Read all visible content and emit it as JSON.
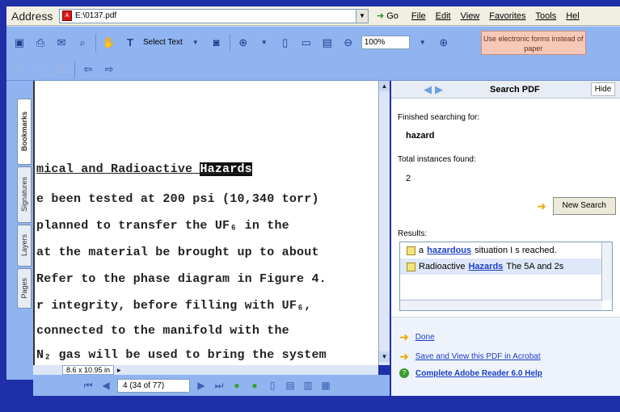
{
  "address_bar": {
    "label": "Address",
    "value": "E:\\0137.pdf",
    "go_label": "Go"
  },
  "menu": [
    "File",
    "Edit",
    "View",
    "Favorites",
    "Tools",
    "Hel"
  ],
  "toolbar": {
    "select_text_label": "Select Text",
    "zoom_value": "100%",
    "eforms_notice": "Use electronic forms instead of paper"
  },
  "left_tabs": [
    "Bookmarks",
    "Signatures",
    "Layers",
    "Pages"
  ],
  "document": {
    "lines": [
      {
        "pre": "mical and Radioactive ",
        "hit": "Hazards",
        "post": ""
      },
      {
        "text": "e been tested at 200 psi (10,340 torr)"
      },
      {
        "text": " planned to transfer the UF₆ in the"
      },
      {
        "text": "at the material be brought up to about"
      },
      {
        "text": "Refer to the phase diagram in Figure 4."
      },
      {
        "text": "r integrity, before filling with UF₆,"
      },
      {
        "text": "connected to the manifold with the"
      },
      {
        "text": " N₂ gas will be used to bring the system"
      }
    ],
    "page_size": "8.6 x 10.95 in"
  },
  "navigation": {
    "page_field": "4  (34 of 77)"
  },
  "search_pane": {
    "title": "Search PDF",
    "hide_label": "Hide",
    "finished_label": "Finished searching for:",
    "term": "hazard",
    "total_label": "Total instances found:",
    "total_count": "2",
    "new_search_label": "New Search",
    "results_label": "Results:",
    "results": [
      {
        "pre": "a ",
        "hit": "hazardous",
        "post": " situation I s reached."
      },
      {
        "pre": "Radioactive ",
        "hit": "Hazards",
        "post": " The 5A and 2s"
      }
    ],
    "footer_links": {
      "done": "Done",
      "save_view": "Save and View this PDF in Acrobat",
      "help": "Complete Adobe Reader 6.0 Help"
    }
  }
}
